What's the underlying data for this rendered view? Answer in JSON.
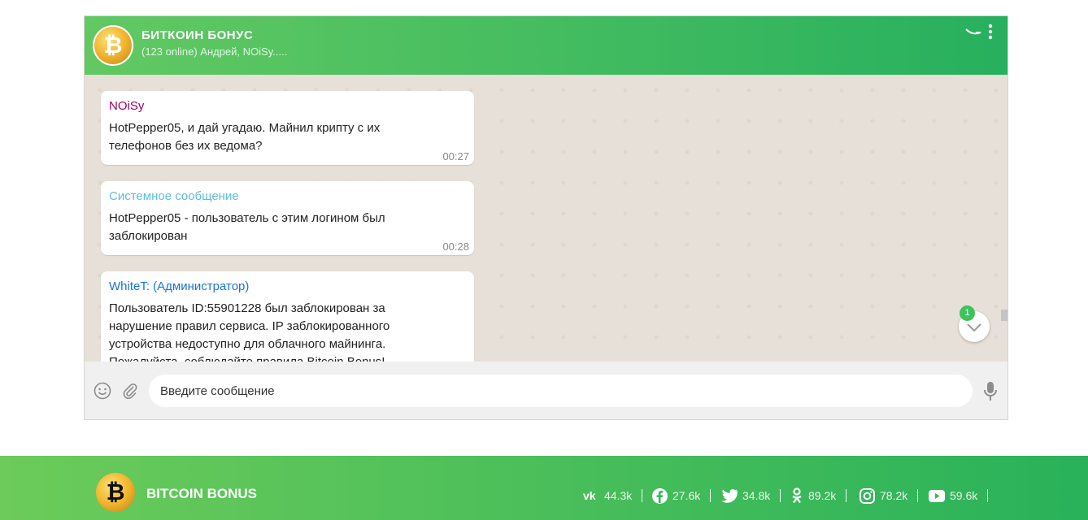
{
  "chat": {
    "title": "БИТКОИН БОНУС",
    "subtitle": "(123 online) Андрей, NOiSy.....",
    "avatar_symbol": "₿",
    "unread_count": "1",
    "messages": [
      {
        "author": "NOiSy",
        "author_color": "#a0005e",
        "text": "HotPepper05, и дай угадаю. Майнил крипту с их телефонов без их ведома?",
        "time": "00:27"
      },
      {
        "author": "Системное сообщение",
        "author_color": "#5bc0de",
        "text": "HotPepper05 - пользователь с этим логином был заблокирован",
        "time": "00:28"
      },
      {
        "author": "WhiteT: (Администратор)",
        "author_color": "#1976d2",
        "text": "Пользователь ID:55901228 был заблокирован за нарушение правил сервиса. IP заблокированного устройства недоступно для облачного майнинга. Пожалуйста, соблюдайте правила Bitcoin Bonus!",
        "time": ""
      }
    ],
    "input_placeholder": "Введите сообщение"
  },
  "footer": {
    "brand": "BITCOIN BONUS",
    "logo_symbol": "₿",
    "socials": [
      {
        "icon": "vk-icon",
        "count": "44.3k"
      },
      {
        "icon": "facebook-icon",
        "count": "27.6k"
      },
      {
        "icon": "twitter-icon",
        "count": "34.8k"
      },
      {
        "icon": "odnoklassniki-icon",
        "count": "89.2k"
      },
      {
        "icon": "instagram-icon",
        "count": "78.2k"
      },
      {
        "icon": "youtube-icon",
        "count": "59.6k"
      }
    ]
  },
  "colors": {
    "header_green": "#3dbb5e",
    "chat_background": "#e6e0d8",
    "badge_green": "#3cc35c"
  }
}
